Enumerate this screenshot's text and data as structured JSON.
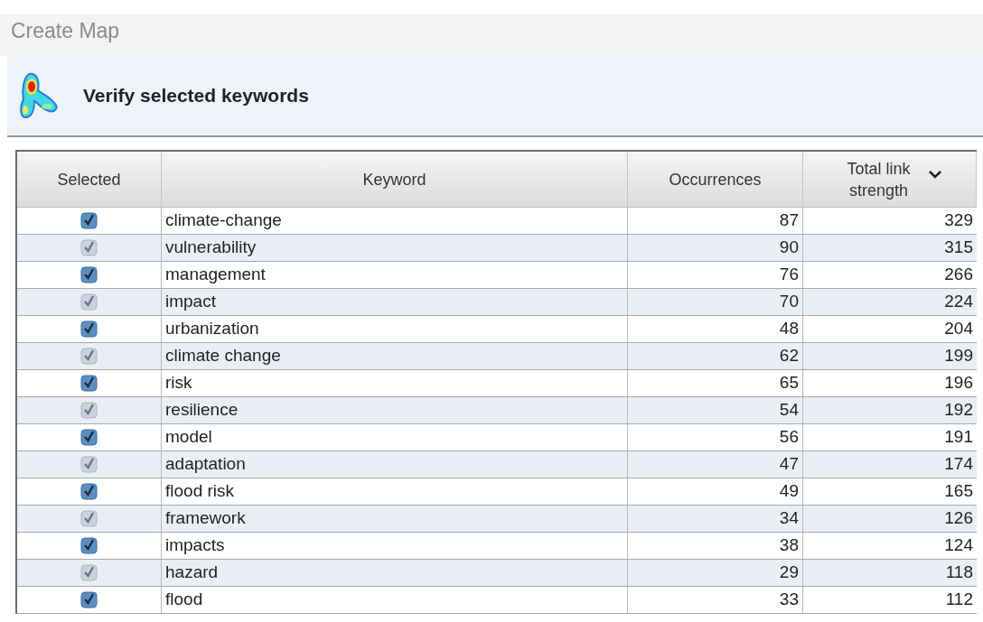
{
  "window": {
    "title": "Create Map"
  },
  "header": {
    "title": "Verify selected keywords"
  },
  "table": {
    "columns": [
      {
        "label": "Selected"
      },
      {
        "label": "Keyword"
      },
      {
        "label": "Occurrences"
      },
      {
        "label": "Total link strength",
        "sorted": true
      }
    ],
    "rows": [
      {
        "checked": true,
        "disabled": false,
        "keyword": "climate-change",
        "occurrences": "87",
        "strength": "329"
      },
      {
        "checked": true,
        "disabled": true,
        "keyword": "vulnerability",
        "occurrences": "90",
        "strength": "315"
      },
      {
        "checked": true,
        "disabled": false,
        "keyword": "management",
        "occurrences": "76",
        "strength": "266"
      },
      {
        "checked": true,
        "disabled": true,
        "keyword": "impact",
        "occurrences": "70",
        "strength": "224"
      },
      {
        "checked": true,
        "disabled": false,
        "keyword": "urbanization",
        "occurrences": "48",
        "strength": "204"
      },
      {
        "checked": true,
        "disabled": true,
        "keyword": "climate change",
        "occurrences": "62",
        "strength": "199"
      },
      {
        "checked": true,
        "disabled": false,
        "keyword": "risk",
        "occurrences": "65",
        "strength": "196"
      },
      {
        "checked": true,
        "disabled": true,
        "keyword": "resilience",
        "occurrences": "54",
        "strength": "192"
      },
      {
        "checked": true,
        "disabled": false,
        "keyword": "model",
        "occurrences": "56",
        "strength": "191"
      },
      {
        "checked": true,
        "disabled": true,
        "keyword": "adaptation",
        "occurrences": "47",
        "strength": "174"
      },
      {
        "checked": true,
        "disabled": false,
        "keyword": "flood risk",
        "occurrences": "49",
        "strength": "165"
      },
      {
        "checked": true,
        "disabled": true,
        "keyword": "framework",
        "occurrences": "34",
        "strength": "126"
      },
      {
        "checked": true,
        "disabled": false,
        "keyword": "impacts",
        "occurrences": "38",
        "strength": "124"
      },
      {
        "checked": true,
        "disabled": true,
        "keyword": "hazard",
        "occurrences": "29",
        "strength": "118"
      },
      {
        "checked": true,
        "disabled": false,
        "keyword": "flood",
        "occurrences": "33",
        "strength": "112"
      }
    ]
  }
}
